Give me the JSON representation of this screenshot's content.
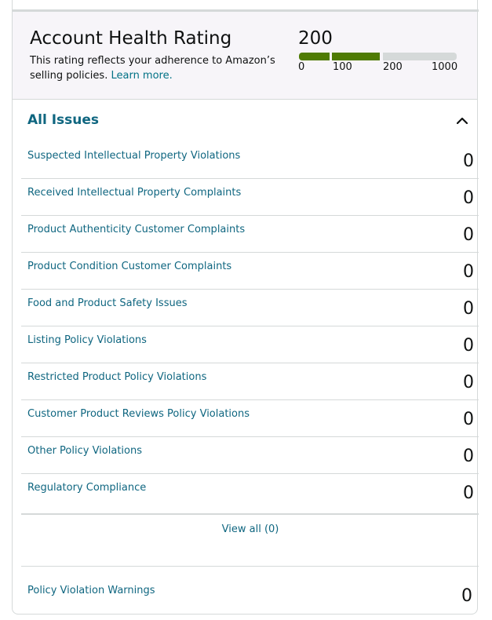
{
  "account_health": {
    "title": "Account Health Rating",
    "description": "This rating reflects your adherence to Amazon’s selling policies.",
    "learn_more": "Learn more.",
    "score": "200",
    "score_value": 200,
    "ticks": [
      "0",
      "100",
      "200",
      "1000"
    ],
    "bar_colors": {
      "filled": "#4f7b04",
      "empty": "#d5d9d9"
    }
  },
  "issues": {
    "title": "All Issues",
    "collapse_icon": "chevron-up-icon",
    "rows": [
      {
        "label": "Suspected Intellectual Property Violations",
        "count": "0"
      },
      {
        "label": "Received Intellectual Property Complaints",
        "count": "0"
      },
      {
        "label": "Product Authenticity Customer Complaints",
        "count": "0"
      },
      {
        "label": "Product Condition Customer Complaints",
        "count": "0"
      },
      {
        "label": "Food and Product Safety Issues",
        "count": "0"
      },
      {
        "label": "Listing Policy Violations",
        "count": "0"
      },
      {
        "label": "Restricted Product Policy Violations",
        "count": "0"
      },
      {
        "label": "Customer Product Reviews Policy Violations",
        "count": "0"
      },
      {
        "label": "Other Policy Violations",
        "count": "0"
      },
      {
        "label": "Regulatory Compliance",
        "count": "0"
      }
    ],
    "view_all": "View all (0)"
  },
  "warnings": {
    "label": "Policy Violation Warnings",
    "count": "0"
  },
  "colors": {
    "link": "#0f6680",
    "panel_bg": "#f7f5f9",
    "border": "#d5d9d9"
  }
}
